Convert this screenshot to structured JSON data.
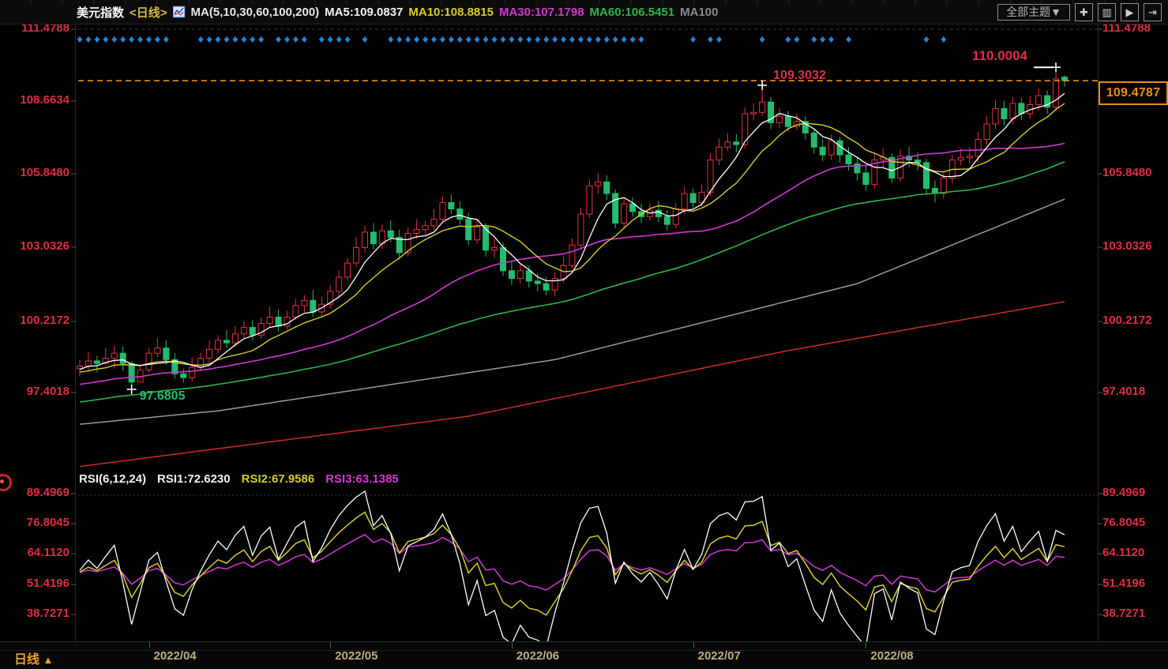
{
  "header": {
    "symbol": "美元指数",
    "period_tag": "<日线>",
    "ma_settings": "MA(5,10,30,60,100,200)",
    "ma_values": [
      {
        "label": "MA5:109.0837",
        "color": "#f2f2f2"
      },
      {
        "label": "MA10:108.8815",
        "color": "#d6cd28"
      },
      {
        "label": "MA30:107.1798",
        "color": "#d238d2"
      },
      {
        "label": "MA60:106.5451",
        "color": "#2eb44b"
      },
      {
        "label": "MA100",
        "color": "#8a8a8a"
      }
    ],
    "theme_button": "全部主题▼",
    "toolbar_icons": [
      "crosshair-icon",
      "indicator-panel-icon",
      "trendline-icon",
      "exit-icon"
    ]
  },
  "rsi_header": {
    "settings": "RSI(6,12,24)",
    "values": [
      {
        "label": "RSI1:72.6230",
        "color": "#f2f2f2"
      },
      {
        "label": "RSI2:67.9586",
        "color": "#d6cd28"
      },
      {
        "label": "RSI3:63.1385",
        "color": "#d238d2"
      }
    ]
  },
  "price_tag": {
    "value": "109.4787"
  },
  "annotations": {
    "low": "97.6805",
    "prev_high": "109.3032",
    "high": "110.0004"
  },
  "bottom_bar": {
    "period": "日线",
    "arrow": "▲"
  },
  "axes": {
    "main_y_labels": [
      "111.4788",
      "108.6634",
      "105.8480",
      "103.0326",
      "100.2172",
      "97.4018"
    ],
    "rsi_y_labels": [
      "89.4969",
      "76.8045",
      "64.1120",
      "51.4196",
      "38.7271"
    ],
    "x_labels": [
      {
        "text": "2022/04",
        "day": 8
      },
      {
        "text": "2022/05",
        "day": 29
      },
      {
        "text": "2022/06",
        "day": 50
      },
      {
        "text": "2022/07",
        "day": 71
      },
      {
        "text": "2022/08",
        "day": 91
      }
    ]
  },
  "colors": {
    "up": "#e2343f",
    "down": "#23bd6f",
    "axis_label": "#dd2e42",
    "ma5": "#ffffff",
    "ma10": "#d6cd28",
    "ma30": "#d238d2",
    "ma60": "#2eb44b",
    "ma100": "#9a9a9a",
    "ma200": "#cc2b2b",
    "dots": "#1f86d9",
    "accent_orange": "#e8900c",
    "grid": "#3a3a3a",
    "marker": "#ffffff"
  },
  "chart_data": {
    "type": "candlestick",
    "title": "美元指数 日线 (US Dollar Index, daily)",
    "x_range_months": [
      "2022/03",
      "2022/08"
    ],
    "main_y_ticks": [
      111.4788,
      108.6634,
      105.848,
      103.0326,
      100.2172,
      97.4018
    ],
    "rsi_y_ticks": [
      89.4969,
      76.8045,
      64.112,
      51.4196,
      38.7271
    ],
    "current_price": 109.4787,
    "ma_periods": [
      5,
      10,
      30,
      60
    ],
    "rsi_periods": [
      6,
      12,
      24
    ],
    "markers": [
      {
        "day": 6,
        "price": 97.6805,
        "kind": "low"
      },
      {
        "day": 79,
        "price": 109.3032,
        "kind": "prev_high"
      },
      {
        "day": 113,
        "price": 110.0004,
        "kind": "high"
      }
    ],
    "signal_dots_days": [
      0,
      1,
      2,
      3,
      4,
      5,
      6,
      7,
      8,
      9,
      10,
      14,
      15,
      16,
      17,
      18,
      19,
      20,
      21,
      23,
      24,
      25,
      26,
      28,
      29,
      30,
      31,
      33,
      36,
      37,
      38,
      39,
      40,
      41,
      42,
      43,
      44,
      45,
      46,
      47,
      48,
      49,
      50,
      51,
      52,
      53,
      54,
      55,
      56,
      57,
      58,
      59,
      60,
      61,
      62,
      63,
      64,
      65,
      71,
      73,
      74,
      79,
      82,
      83,
      85,
      86,
      87,
      89,
      98,
      100
    ],
    "ma100_keypoints": [
      [
        0,
        96.14
      ],
      [
        16,
        96.66
      ],
      [
        55,
        98.65
      ],
      [
        90,
        101.6
      ],
      [
        114,
        104.88
      ]
    ],
    "ma200_keypoints": [
      [
        0,
        94.5
      ],
      [
        45,
        96.45
      ],
      [
        82,
        99.0
      ],
      [
        114,
        100.9
      ]
    ],
    "candles": [
      [
        98.3,
        98.65,
        98.0,
        98.4
      ],
      [
        98.4,
        98.95,
        98.2,
        98.6
      ],
      [
        98.6,
        98.8,
        98.15,
        98.5
      ],
      [
        98.5,
        99.1,
        98.45,
        98.7
      ],
      [
        98.7,
        99.2,
        98.3,
        98.9
      ],
      [
        98.9,
        99.15,
        98.2,
        98.5
      ],
      [
        98.5,
        98.6,
        97.6805,
        97.78
      ],
      [
        97.78,
        98.45,
        97.75,
        98.25
      ],
      [
        98.25,
        99.1,
        98.15,
        98.9
      ],
      [
        98.9,
        99.5,
        98.75,
        99.1
      ],
      [
        99.1,
        99.4,
        98.45,
        98.65
      ],
      [
        98.65,
        98.9,
        97.9,
        98.1
      ],
      [
        98.1,
        98.3,
        97.75,
        97.95
      ],
      [
        97.95,
        98.75,
        97.8,
        98.35
      ],
      [
        98.35,
        98.9,
        98.2,
        98.7
      ],
      [
        98.7,
        99.4,
        98.55,
        99.05
      ],
      [
        99.05,
        99.6,
        98.9,
        99.4
      ],
      [
        99.4,
        99.8,
        99.1,
        99.3
      ],
      [
        99.3,
        99.95,
        99.15,
        99.65
      ],
      [
        99.65,
        100.15,
        99.5,
        99.9
      ],
      [
        99.9,
        100.2,
        99.4,
        99.6
      ],
      [
        99.6,
        100.3,
        99.45,
        100.05
      ],
      [
        100.05,
        100.7,
        99.9,
        100.3
      ],
      [
        100.3,
        100.6,
        99.75,
        99.95
      ],
      [
        99.95,
        100.55,
        99.8,
        100.3
      ],
      [
        100.3,
        101.0,
        100.2,
        100.75
      ],
      [
        100.75,
        101.15,
        100.5,
        100.95
      ],
      [
        100.95,
        101.35,
        100.3,
        100.5
      ],
      [
        100.5,
        101.1,
        100.35,
        100.8
      ],
      [
        100.8,
        101.55,
        100.65,
        101.3
      ],
      [
        101.3,
        102.1,
        101.1,
        101.85
      ],
      [
        101.85,
        102.6,
        101.7,
        102.4
      ],
      [
        102.4,
        103.4,
        102.25,
        103.0
      ],
      [
        103.0,
        103.85,
        102.8,
        103.6
      ],
      [
        103.6,
        103.95,
        102.95,
        103.15
      ],
      [
        103.15,
        103.9,
        102.95,
        103.65
      ],
      [
        103.65,
        104.05,
        103.2,
        103.4
      ],
      [
        103.4,
        103.7,
        102.55,
        102.8
      ],
      [
        102.8,
        103.8,
        102.65,
        103.55
      ],
      [
        103.55,
        104.1,
        103.35,
        103.7
      ],
      [
        103.7,
        104.05,
        103.5,
        103.85
      ],
      [
        103.85,
        104.5,
        103.7,
        104.1
      ],
      [
        104.1,
        105.0,
        103.95,
        104.75
      ],
      [
        104.75,
        105.05,
        104.3,
        104.5
      ],
      [
        104.5,
        104.8,
        103.9,
        104.1
      ],
      [
        104.1,
        104.35,
        103.1,
        103.3
      ],
      [
        103.3,
        104.1,
        103.15,
        103.8
      ],
      [
        103.8,
        103.95,
        102.65,
        102.9
      ],
      [
        102.9,
        103.35,
        102.6,
        103.0
      ],
      [
        103.0,
        103.2,
        101.9,
        102.1
      ],
      [
        102.1,
        102.45,
        101.55,
        101.8
      ],
      [
        101.8,
        102.35,
        101.6,
        102.1
      ],
      [
        102.1,
        102.3,
        101.45,
        101.7
      ],
      [
        101.7,
        102.0,
        101.3,
        101.6
      ],
      [
        101.6,
        101.85,
        101.15,
        101.35
      ],
      [
        101.35,
        102.05,
        101.1,
        101.8
      ],
      [
        101.8,
        102.65,
        101.65,
        102.3
      ],
      [
        102.3,
        103.35,
        102.2,
        103.1
      ],
      [
        103.1,
        104.55,
        102.95,
        104.3
      ],
      [
        104.3,
        105.65,
        104.15,
        105.4
      ],
      [
        105.4,
        105.9,
        105.1,
        105.55
      ],
      [
        105.55,
        105.8,
        104.85,
        105.1
      ],
      [
        105.1,
        105.25,
        103.75,
        103.95
      ],
      [
        103.95,
        104.95,
        103.8,
        104.7
      ],
      [
        104.7,
        104.95,
        104.2,
        104.4
      ],
      [
        104.4,
        104.7,
        103.95,
        104.2
      ],
      [
        104.2,
        104.75,
        104.05,
        104.45
      ],
      [
        104.45,
        104.8,
        104.0,
        104.2
      ],
      [
        104.2,
        104.45,
        103.65,
        103.9
      ],
      [
        103.9,
        104.75,
        103.75,
        104.5
      ],
      [
        104.5,
        105.35,
        104.3,
        105.1
      ],
      [
        105.1,
        105.3,
        104.55,
        104.75
      ],
      [
        104.75,
        105.45,
        104.6,
        105.15
      ],
      [
        105.15,
        106.65,
        105.0,
        106.4
      ],
      [
        106.4,
        107.25,
        106.2,
        106.9
      ],
      [
        106.9,
        107.45,
        106.75,
        107.1
      ],
      [
        107.1,
        107.4,
        106.7,
        107.0
      ],
      [
        107.0,
        108.45,
        106.85,
        108.2
      ],
      [
        108.2,
        108.6,
        107.95,
        108.25
      ],
      [
        108.25,
        109.3032,
        108.1,
        108.65
      ],
      [
        108.65,
        108.85,
        107.6,
        107.85
      ],
      [
        107.85,
        108.4,
        107.65,
        108.1
      ],
      [
        108.1,
        108.3,
        107.5,
        107.7
      ],
      [
        107.7,
        108.2,
        107.55,
        107.9
      ],
      [
        107.9,
        108.1,
        107.2,
        107.45
      ],
      [
        107.45,
        107.6,
        106.65,
        106.9
      ],
      [
        106.9,
        107.2,
        106.35,
        106.6
      ],
      [
        106.6,
        107.4,
        106.4,
        107.15
      ],
      [
        107.15,
        107.3,
        106.3,
        106.6
      ],
      [
        106.6,
        106.9,
        106.0,
        106.25
      ],
      [
        106.25,
        106.5,
        105.6,
        105.9
      ],
      [
        105.9,
        106.2,
        105.2,
        105.45
      ],
      [
        105.45,
        106.7,
        105.3,
        106.4
      ],
      [
        106.4,
        106.85,
        106.1,
        106.5
      ],
      [
        106.5,
        106.65,
        105.5,
        105.7
      ],
      [
        105.7,
        106.8,
        105.55,
        106.55
      ],
      [
        106.55,
        106.9,
        106.1,
        106.4
      ],
      [
        106.4,
        106.7,
        106.0,
        106.3
      ],
      [
        106.3,
        106.45,
        105.05,
        105.3
      ],
      [
        105.3,
        105.6,
        104.75,
        105.1
      ],
      [
        105.1,
        105.95,
        104.9,
        105.7
      ],
      [
        105.7,
        106.6,
        105.5,
        106.4
      ],
      [
        106.4,
        106.85,
        106.2,
        106.5
      ],
      [
        106.5,
        106.9,
        106.25,
        106.55
      ],
      [
        106.55,
        107.5,
        106.3,
        107.2
      ],
      [
        107.2,
        108.1,
        107.0,
        107.8
      ],
      [
        107.8,
        108.75,
        107.6,
        108.4
      ],
      [
        108.4,
        108.7,
        107.75,
        108.0
      ],
      [
        108.0,
        108.85,
        107.8,
        108.6
      ],
      [
        108.6,
        108.8,
        107.95,
        108.2
      ],
      [
        108.2,
        108.9,
        108.0,
        108.55
      ],
      [
        108.55,
        109.2,
        108.3,
        108.9
      ],
      [
        108.9,
        109.1,
        108.2,
        108.45
      ],
      [
        108.45,
        110.0004,
        108.3,
        109.55
      ],
      [
        109.62,
        109.68,
        109.25,
        109.4787
      ]
    ]
  }
}
